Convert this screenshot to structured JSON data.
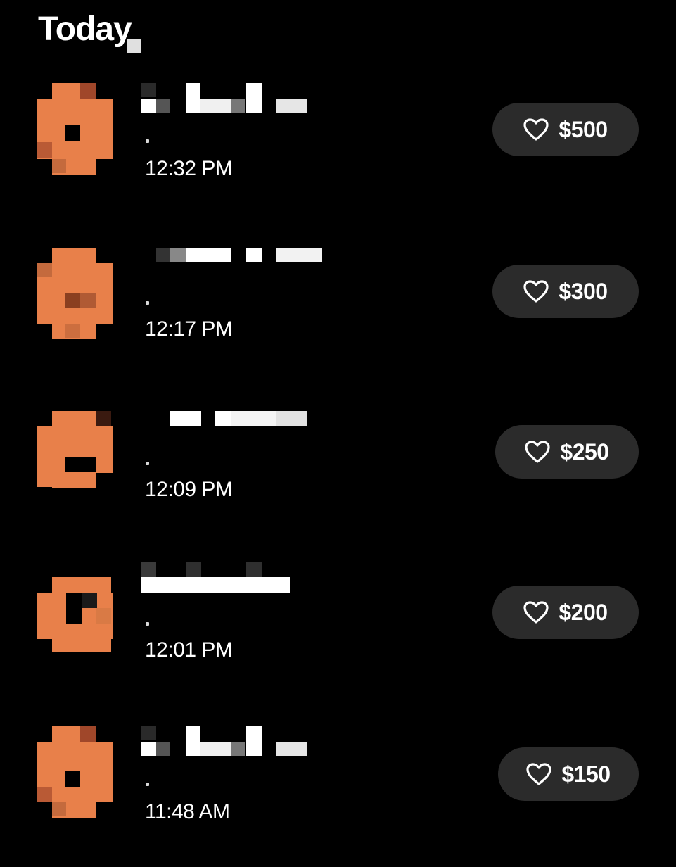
{
  "header": {
    "title": "Today"
  },
  "colors": {
    "background": "#000000",
    "avatar": "#E8804A",
    "pill": "#2B2B2B",
    "text": "#FFFFFF"
  },
  "gifts": [
    {
      "time": "12:32 PM",
      "amount": "$500",
      "icon": "heart-icon"
    },
    {
      "time": "12:17 PM",
      "amount": "$300",
      "icon": "heart-icon"
    },
    {
      "time": "12:09 PM",
      "amount": "$250",
      "icon": "heart-icon"
    },
    {
      "time": "12:01 PM",
      "amount": "$200",
      "icon": "heart-icon"
    },
    {
      "time": "11:48 AM",
      "amount": "$150",
      "icon": "heart-icon"
    }
  ]
}
